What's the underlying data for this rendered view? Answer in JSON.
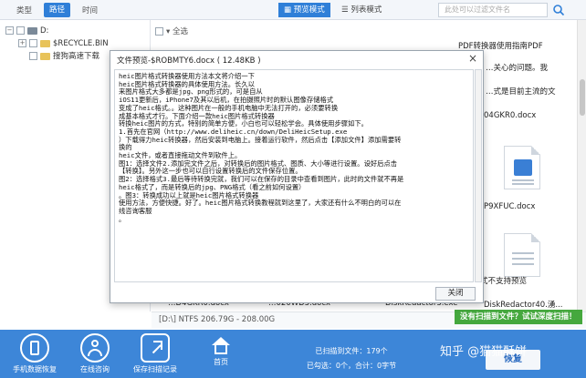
{
  "header": {
    "tabs": [
      "类型",
      "路径",
      "时间"
    ],
    "active_tab": "路径",
    "view_modes": [
      "预览模式",
      "列表模式"
    ],
    "search_placeholder": "此处可以过滤文件名"
  },
  "tree": {
    "drive": "D:",
    "items": [
      "$RECYCLE.BIN",
      "搜狗高速下载"
    ]
  },
  "file_area": {
    "select_all": "全选",
    "files": [
      {
        "name": "PDF转换器使用指南PDF"
      },
      {
        "name": "…关心的问题。我"
      },
      {
        "name": "…式是目前主流的文"
      },
      {
        "name": "04GKR0.docx"
      },
      {
        "name": "P9XFUC.docx"
      },
      {
        "name": "式不支持预览"
      },
      {
        "name": "…D4GKR0.docx"
      },
      {
        "name": "…020WD3.docx"
      },
      {
        "name": "DiskRedactor3.exe"
      },
      {
        "name": "DiskRedactor40.湧..."
      }
    ]
  },
  "status": {
    "drive_info": "[D:\\] NTFS 206.79G - 208.00G",
    "deep_scan": "没有扫描到文件？试试深度扫描！"
  },
  "bottom": {
    "buttons": [
      "手机数据恢复",
      "在线咨询",
      "保存扫描记录"
    ],
    "home": "首页",
    "scanned_label": "已扫描到文件：",
    "scanned_count": "179个",
    "selected_label": "已勾选：",
    "selected_count": "0个，合计：0字节",
    "watermark": "知乎 @猫猫酥饼",
    "recover_button": "恢复"
  },
  "dialog": {
    "title": "文件预览-$ROBMTY6.docx ( 12.48KB )",
    "close_label": "关闭",
    "lines": [
      "heic图片格式转换器使用方法本文将介绍一下",
      "heic图片格式转换器的具体使用方法。长久以",
      "来图片格式大多都是jpg、png形式的，可是自从",
      "iOS11更新后，iPhone7及其以后机，在拍摄照片时的默认图像存储格式",
      "变成了heic格式。。这种图片在一般的手机电脑中无法打开的，必须要转换",
      "成基本格式才行。下面介绍一款heic图片格式转换器",
      "转换heic图片的方式，特别的简单方便，小白也可以轻松学会。具体使用步骤如下。",
      "1.首先在官网（http://www.deliheic.cn/down/DeliHeicSetup.exe",
      "）下载得力heic转换器，然后安装到电脑上。接着运行软件，然后点击【添加文件】添加需要转",
      "换的",
      "heic文件，或者直接拖动文件到软件上。",
      "图1：选择文件2.添加完文件之后，对转换后的图片格式、图质、大小等进行设置。设好后点击",
      "【转换】。另外这一步也可以自行设置转换后的文件保存位置。",
      "图2：选择格式3.最后等待转换完就，我们可以在保存的目录中查看到图片，此时的文件就不再是",
      "heic格式了，而是转换后的jpg、PNG格式（看之前如何设置）",
      "。图3：转换成功以上就是heic图片格式转换器",
      "使用方法，方便快捷。好了。heic图片格式转换教程就到这里了，大家还有什么不明白的可以在",
      "线咨询客服",
      "。"
    ]
  }
}
